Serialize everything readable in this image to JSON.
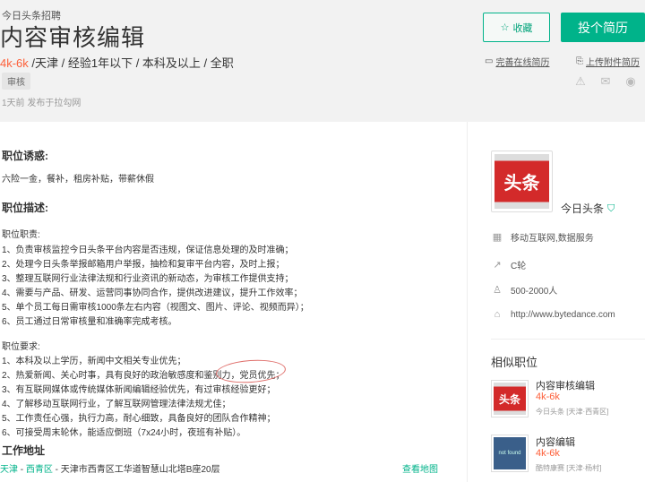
{
  "header": {
    "company_link": "今日头条招聘",
    "job_title": "内容审核编辑",
    "salary": "4k-6k",
    "meta_rest": " /天津 / 经验1年以下 / 本科及以上 / 全职",
    "tag": "审核",
    "publish": "1天前  发布于拉勾网",
    "favorite_label": "收藏",
    "apply_label": "投个简历",
    "online_resume": "完善在线简历",
    "upload_resume": "上传附件简历"
  },
  "main": {
    "perks_title": "职位诱惑:",
    "perks": "六险一金，餐补，租房补贴，带薪休假",
    "desc_title": "职位描述:",
    "duties_title": "职位职责:",
    "duties": [
      "1、负责审核监控今日头条平台内容是否违规，保证信息处理的及时准确；",
      "2、处理今日头条举报邮箱用户举报，抽检和复审平台内容，及时上报；",
      "3、整理互联网行业法律法规和行业资讯的新动态，为审核工作提供支持；",
      "4、需要与产品、研发、运营同事协同合作，提供改进建议，提升工作效率；",
      "5、单个员工每日需审核1000条左右内容（视图文、图片、评论、视频而异）；",
      "6、员工通过日常审核量和准确率完成考核。"
    ],
    "req_title": "职位要求:",
    "requirements": [
      "1、本科及以上学历，新闻中文相关专业优先；",
      "2、热爱新闻、关心时事，具有良好的政治敏感度和鉴别力，党员优先；",
      "3、有互联网媒体或传统媒体新闻编辑经验优先，有过审核经验更好；",
      "4、了解移动互联网行业，了解互联网管理法律法规尤佳；",
      "5、工作责任心强，执行力高，耐心细致，具备良好的团队合作精神；",
      "6、可接受周末轮休，能适应倒班（7x24小时，夜班有补贴）。"
    ],
    "address_title": "工作地址",
    "addr_city": "天津",
    "addr_sep1": " - ",
    "addr_district": "西青区",
    "addr_rest": " -  天津市西青区工华道智慧山北塔B座20层",
    "map_link": "查看地图"
  },
  "sidebar": {
    "logo_text": "头条",
    "company_name": "今日头条",
    "field": "移动互联网,数据服务",
    "stage": "C轮",
    "size": "500-2000人",
    "website": "http://www.bytedance.com",
    "similar_title": "相似职位",
    "similar": [
      {
        "title": "内容审核编辑",
        "salary": "4k-6k",
        "company": "今日头条 [天津·西青区]",
        "logo_text": "头条"
      },
      {
        "title": "内容编辑",
        "salary": "4k-6k",
        "company": "酷特康赛 [天津·杨村]",
        "logo_text": "not found"
      }
    ]
  },
  "colors": {
    "brand_green": "#00b38a",
    "salary_orange": "#fd5f39",
    "header_bg": "#f2f2f2"
  }
}
